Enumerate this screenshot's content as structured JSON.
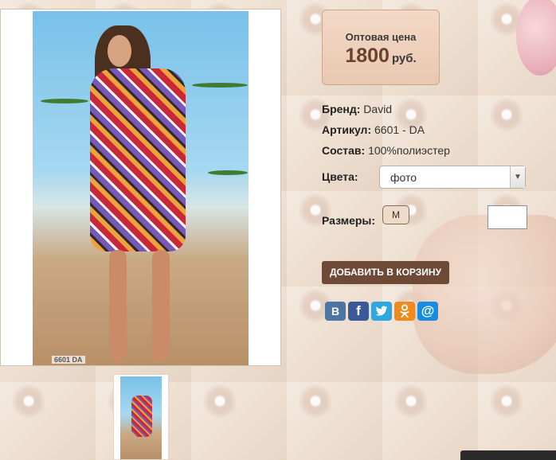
{
  "product_photo": {
    "code_label": "6601 DA"
  },
  "price": {
    "label": "Оптовая цена",
    "value": "1800",
    "currency": "руб."
  },
  "details": {
    "brand_label": "Бренд:",
    "brand_value": "David",
    "article_label": "Артикул:",
    "article_value": "6601 - DA",
    "composition_label": "Состав:",
    "composition_value": "100%полиэстер"
  },
  "colors": {
    "label": "Цвета:",
    "selected": "фото"
  },
  "sizes": {
    "label": "Размеры:",
    "options": [
      "M"
    ],
    "quantity": ""
  },
  "cart": {
    "add_button": "ДОБАВИТЬ В КОРЗИНУ"
  },
  "share": {
    "icons": [
      "vk-icon",
      "facebook-icon",
      "twitter-icon",
      "odnoklassniki-icon",
      "mailru-icon"
    ],
    "vk": "В",
    "fb": "f",
    "tw": "🐦",
    "ok": "ок",
    "mr": "@"
  },
  "colors_theme": {
    "price_text": "#6a4030",
    "button_bg": "#6e4a36",
    "background": "#eedfd0"
  }
}
